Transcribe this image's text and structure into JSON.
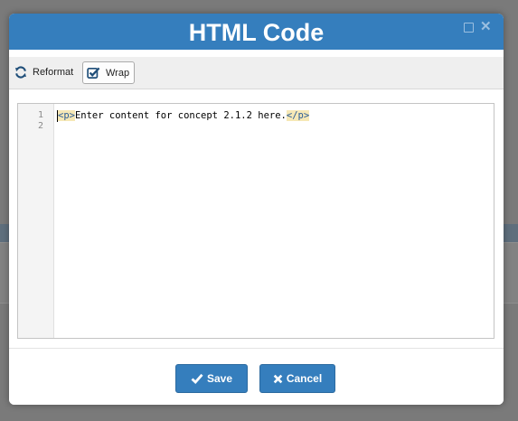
{
  "dialog": {
    "title": "HTML Code",
    "maximize_icon": "maximize-icon",
    "close_icon": "close-icon"
  },
  "toolbar": {
    "reformat_label": "Reformat",
    "reformat_icon": "refresh-icon",
    "wrap_label": "Wrap",
    "wrap_icon": "checkbox-checked-icon",
    "wrap_checked": true
  },
  "editor": {
    "line_numbers": [
      "1",
      "2"
    ],
    "lines": [
      {
        "open_tag": "<p>",
        "text": "Enter content for concept 2.1.2 here.",
        "close_tag": "</p>"
      },
      {
        "open_tag": "",
        "text": "",
        "close_tag": ""
      }
    ]
  },
  "footer": {
    "save_label": "Save",
    "save_icon": "check-icon",
    "cancel_label": "Cancel",
    "cancel_icon": "x-icon"
  },
  "colors": {
    "accent": "#357ebd",
    "overlay": "#7a7a7a",
    "tag_highlight": "#f6e8b6"
  }
}
